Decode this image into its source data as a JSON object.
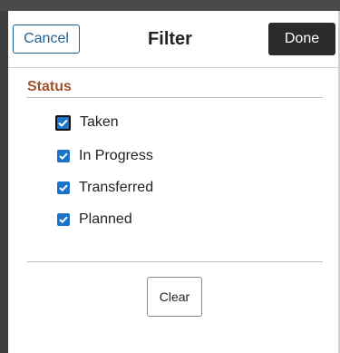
{
  "header": {
    "cancel_label": "Cancel",
    "title": "Filter",
    "done_label": "Done"
  },
  "status_section": {
    "title": "Status",
    "options": [
      {
        "label": "Taken",
        "checked": true,
        "focused": true
      },
      {
        "label": "In Progress",
        "checked": true,
        "focused": false
      },
      {
        "label": "Transferred",
        "checked": true,
        "focused": false
      },
      {
        "label": "Planned",
        "checked": true,
        "focused": false
      }
    ]
  },
  "footer": {
    "clear_label": "Clear"
  },
  "colors": {
    "accent": "#1a73c9",
    "section_title": "#a0522d",
    "cancel_text": "#1f5f92",
    "done_bg": "#2b2b2b"
  }
}
